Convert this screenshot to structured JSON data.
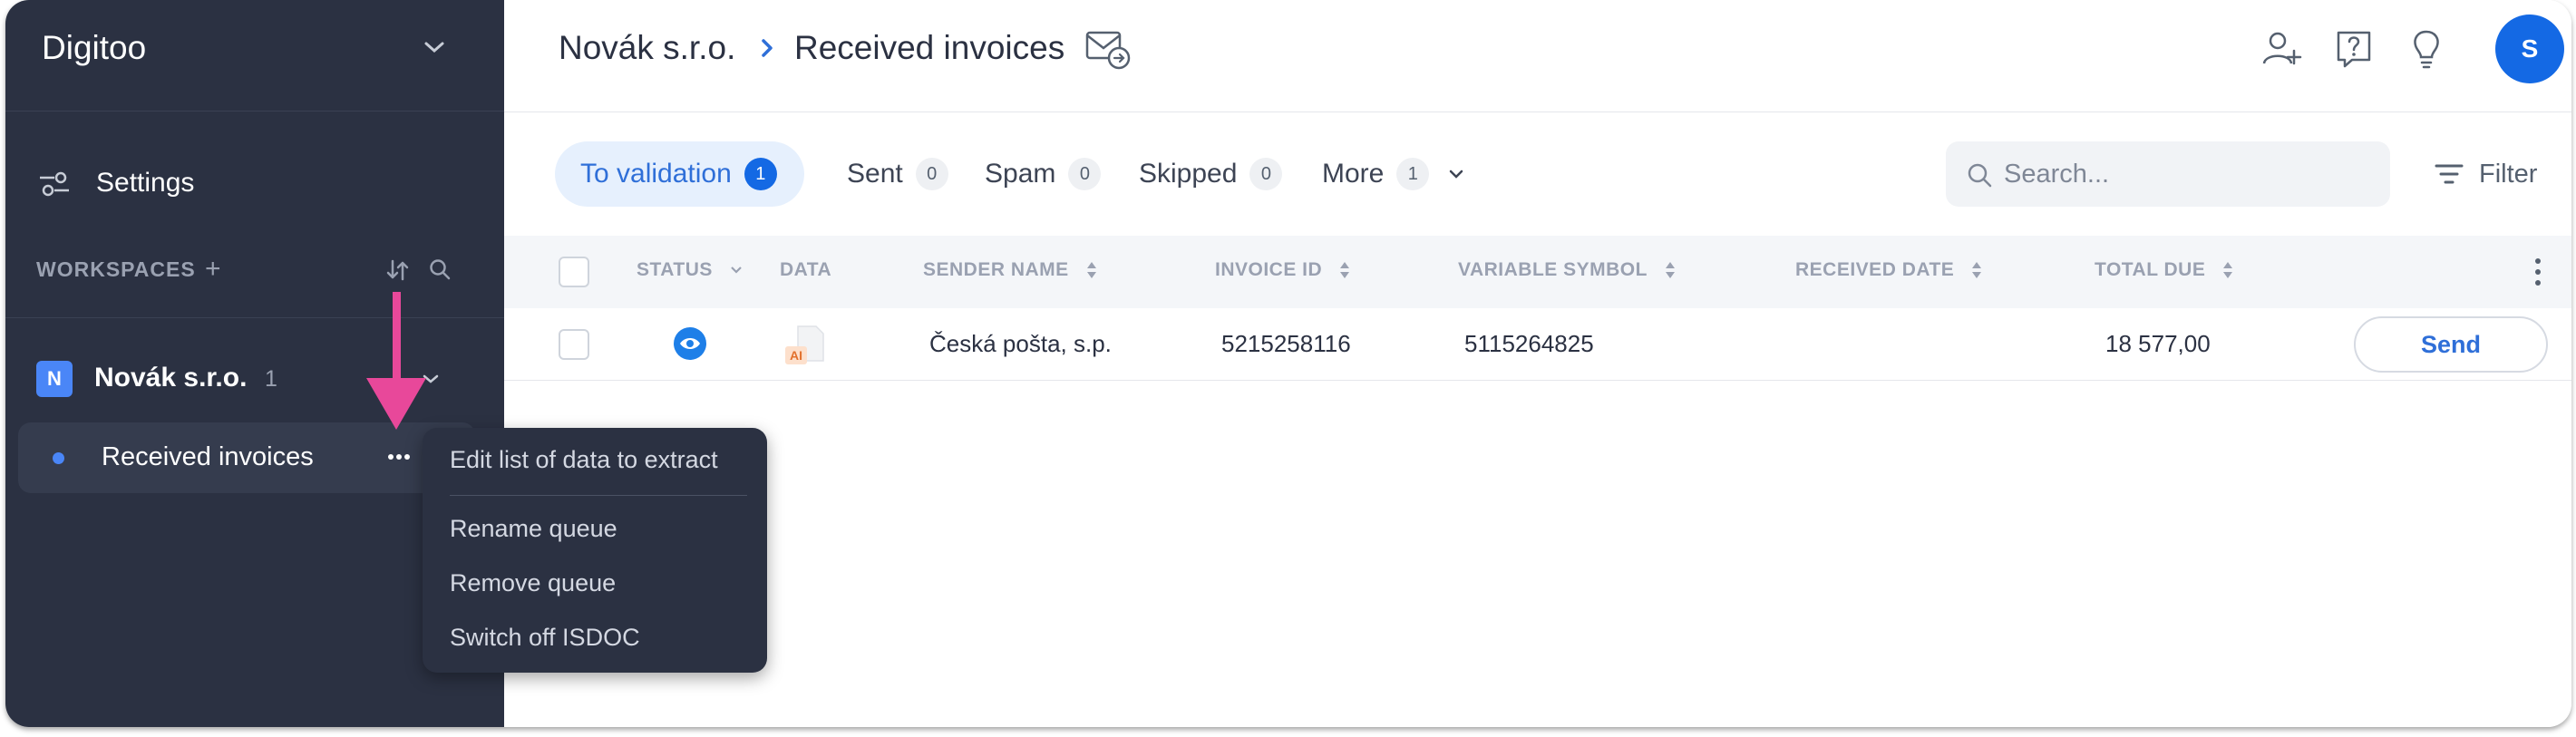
{
  "sidebar": {
    "app_title": "Digitoo",
    "settings_label": "Settings",
    "workspaces_label": "WORKSPACES",
    "workspaces_add": "+",
    "company": {
      "badge": "N",
      "name": "Novák s.r.o.",
      "count": "1"
    },
    "queue": {
      "label": "Received invoices"
    }
  },
  "context_menu": {
    "items": [
      "Edit list of data to extract",
      "Rename queue",
      "Remove queue",
      "Switch off ISDOC"
    ]
  },
  "header": {
    "breadcrumb_company": "Novák s.r.o.",
    "breadcrumb_current": "Received invoices",
    "avatar_initial": "S"
  },
  "tabs": [
    {
      "label": "To validation",
      "count": "1",
      "active": true
    },
    {
      "label": "Sent",
      "count": "0"
    },
    {
      "label": "Spam",
      "count": "0"
    },
    {
      "label": "Skipped",
      "count": "0"
    },
    {
      "label": "More",
      "count": "1"
    }
  ],
  "search": {
    "placeholder": "Search..."
  },
  "filter_label": "Filter",
  "table": {
    "columns": [
      "STATUS",
      "DATA",
      "SENDER NAME",
      "INVOICE ID",
      "VARIABLE SYMBOL",
      "RECEIVED DATE",
      "TOTAL DUE"
    ],
    "rows": [
      {
        "sender": "Česká pošta, s.p.",
        "invoice_id": "5215258116",
        "variable_symbol": "5115264825",
        "received_date": "",
        "total_due": "18 577,00",
        "doc_badge": "AI",
        "action": "Send"
      }
    ]
  },
  "colors": {
    "sidebar_bg": "#2b3142",
    "accent": "#1469e4",
    "annotation_arrow": "#e8489a"
  },
  "icons": [
    "chevron-down-icon",
    "settings-sliders-icon",
    "sort-icon",
    "search-icon",
    "more-horizontal-icon",
    "chevron-right-icon",
    "mail-forward-icon",
    "add-user-icon",
    "help-icon",
    "lightbulb-icon",
    "filter-icon",
    "sort-arrows-icon",
    "kebab-icon",
    "eye-status-icon",
    "document-icon"
  ]
}
